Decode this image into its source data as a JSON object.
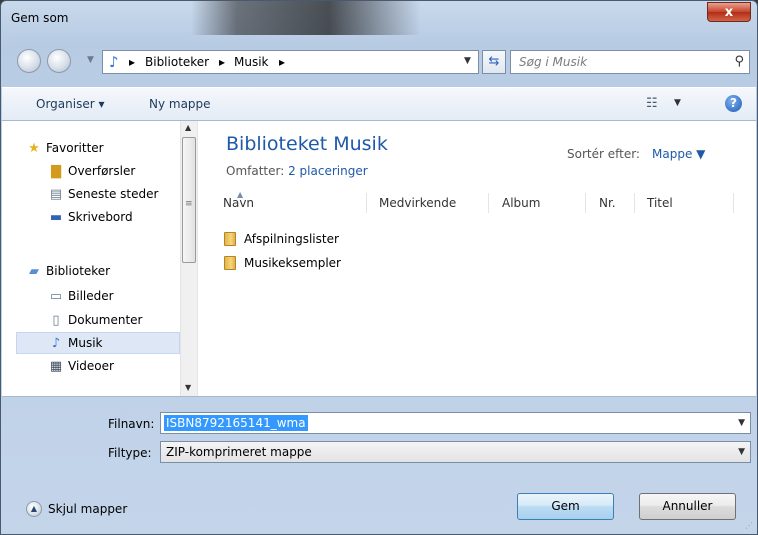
{
  "window": {
    "title": "Gem som",
    "close_glyph": "x"
  },
  "address": {
    "icon": "music-note-icon",
    "crumbs": [
      "Biblioteker",
      "Musik"
    ],
    "search_placeholder": "Søg i Musik"
  },
  "toolbar": {
    "organize": "Organiser",
    "new_folder": "Ny mappe"
  },
  "nav": {
    "favorites_header": "Favoritter",
    "favorites": [
      "Overførsler",
      "Seneste steder",
      "Skrivebord"
    ],
    "libraries_header": "Biblioteker",
    "libraries": [
      "Billeder",
      "Dokumenter",
      "Musik",
      "Videoer"
    ],
    "selected": "Musik"
  },
  "library": {
    "title": "Biblioteket Musik",
    "includes_label": "Omfatter:",
    "includes_link": "2 placeringer",
    "sort_label": "Sortér efter:",
    "sort_value": "Mappe"
  },
  "columns": [
    "Navn",
    "Medvirkende",
    "Album",
    "Nr.",
    "Titel"
  ],
  "files": [
    "Afspilningslister",
    "Musikeksempler"
  ],
  "form": {
    "filename_label": "Filnavn:",
    "filename_value": "ISBN8792165141_wma",
    "filetype_label": "Filtype:",
    "filetype_value": "ZIP-komprimeret mappe"
  },
  "footer": {
    "hide_folders": "Skjul mapper",
    "save": "Gem",
    "cancel": "Annuller"
  },
  "colors": {
    "accent": "#1e5aa8",
    "selection": "#3399ff",
    "close": "#c5432a"
  }
}
